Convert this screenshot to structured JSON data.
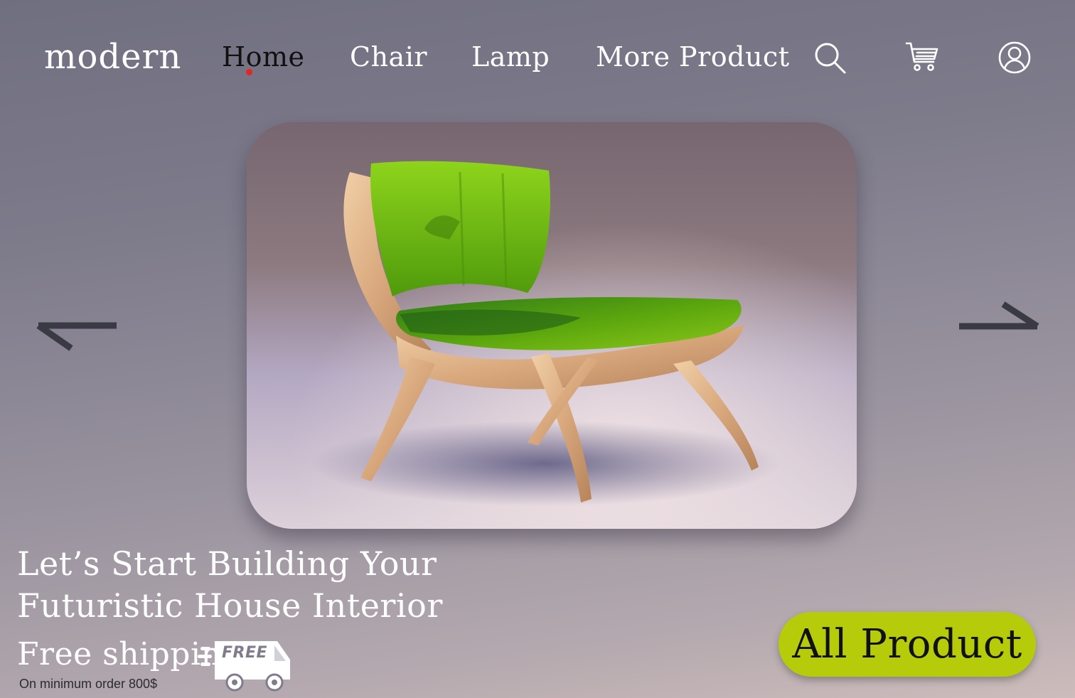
{
  "brand": {
    "logo": "modern"
  },
  "nav": {
    "items": [
      {
        "label": "Home",
        "active": true
      },
      {
        "label": "Chair"
      },
      {
        "label": "Lamp"
      },
      {
        "label": "More Product"
      }
    ],
    "icons": [
      "search-icon",
      "cart-icon",
      "user-icon"
    ],
    "active_indicator_color": "#e8241f"
  },
  "hero": {
    "image": "green-lounge-chair",
    "prev": "arrow-left-icon",
    "next": "arrow-right-icon"
  },
  "headline": "Let’s Start Building Your Futuristic House Interior",
  "shipping": {
    "title": "Free shipping",
    "note": "On minimum order 800$",
    "badge": "FREE"
  },
  "cta": {
    "label": "All Product",
    "color": "#b6cc0a"
  }
}
